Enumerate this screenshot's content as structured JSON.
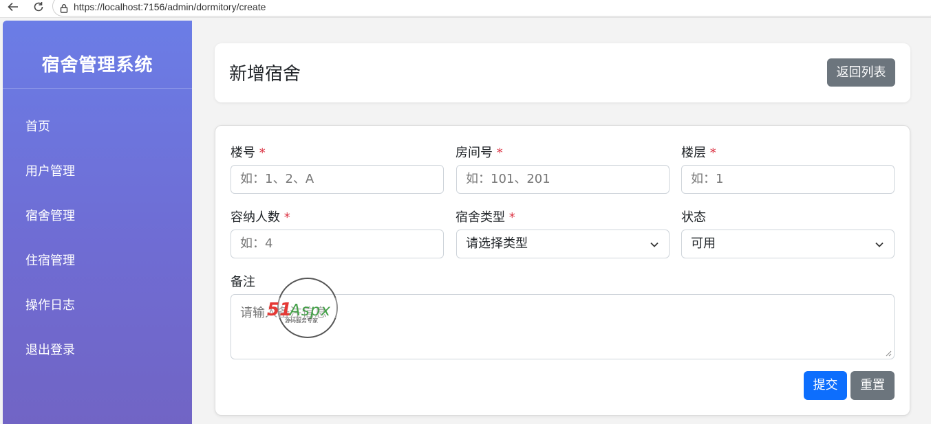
{
  "browser": {
    "url": "https://localhost:7156/admin/dormitory/create"
  },
  "sidebar": {
    "brand": "宿舍管理系统",
    "items": [
      {
        "label": "首页"
      },
      {
        "label": "用户管理"
      },
      {
        "label": "宿舍管理"
      },
      {
        "label": "住宿管理"
      },
      {
        "label": "操作日志"
      },
      {
        "label": "退出登录"
      }
    ]
  },
  "header": {
    "title": "新增宿舍",
    "back_label": "返回列表"
  },
  "form": {
    "required_mark": "*",
    "building": {
      "label": "楼号",
      "placeholder": "如：1、2、A"
    },
    "room": {
      "label": "房间号",
      "placeholder": "如：101、201"
    },
    "floor": {
      "label": "楼层",
      "placeholder": "如：1"
    },
    "capacity": {
      "label": "容纳人数",
      "placeholder": "如：4"
    },
    "type": {
      "label": "宿舍类型",
      "value": "请选择类型"
    },
    "status": {
      "label": "状态",
      "value": "可用"
    },
    "remark": {
      "label": "备注",
      "placeholder": "请输入备注信息"
    },
    "submit_label": "提交",
    "reset_label": "重置"
  },
  "watermark": {
    "brand_left": "51",
    "brand_right": "Aspx",
    "tagline": "源码服务专家"
  },
  "colors": {
    "primary": "#0d6efd",
    "secondary": "#6c757d",
    "required": "#dc3545",
    "sidebar_top": "#6b7de6",
    "sidebar_bottom": "#7164c4"
  }
}
